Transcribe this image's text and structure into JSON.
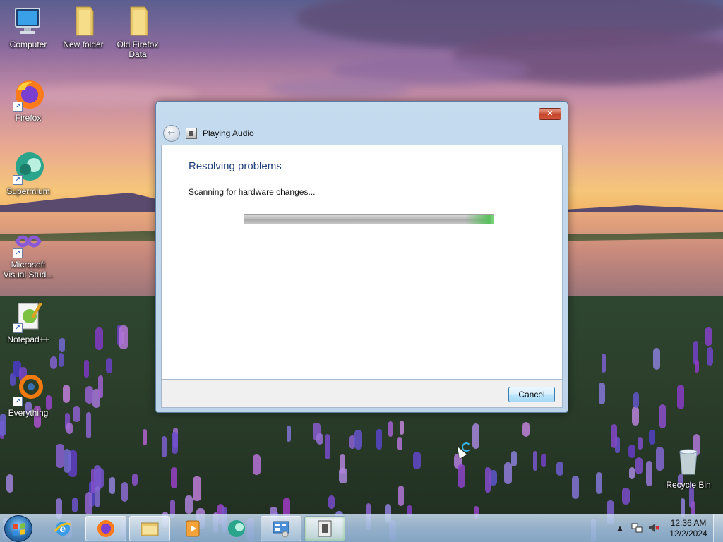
{
  "desktop": {
    "icons": [
      {
        "label": "Computer",
        "icon": "computer-icon"
      },
      {
        "label": "New folder",
        "icon": "folder-icon"
      },
      {
        "label": "Old Firefox Data",
        "icon": "folder-icon"
      },
      {
        "label": "Firefox",
        "icon": "firefox-icon"
      },
      {
        "label": "Supermium",
        "icon": "supermium-icon"
      },
      {
        "label": "Microsoft Visual Stud...",
        "icon": "visual-studio-icon"
      },
      {
        "label": "Notepad++",
        "icon": "notepadpp-icon"
      },
      {
        "label": "Everything",
        "icon": "everything-icon"
      },
      {
        "label": "Recycle Bin",
        "icon": "recycle-bin-icon"
      }
    ]
  },
  "window": {
    "title": "Playing Audio",
    "heading": "Resolving problems",
    "status": "Scanning for hardware changes...",
    "progress": 1.0,
    "cancel_label": "Cancel",
    "close_glyph": "✕"
  },
  "taskbar": {
    "pinned": [
      {
        "name": "internet-explorer-icon",
        "state": "pinned"
      },
      {
        "name": "firefox-icon",
        "state": "open"
      },
      {
        "name": "file-explorer-icon",
        "state": "open"
      },
      {
        "name": "media-player-icon",
        "state": "pinned"
      },
      {
        "name": "supermium-icon",
        "state": "pinned"
      },
      {
        "name": "control-panel-icon",
        "state": "open"
      },
      {
        "name": "troubleshooter-icon",
        "state": "active"
      }
    ],
    "clock": {
      "time": "12:36 AM",
      "date": "12/2/2024"
    },
    "tray_arrow": "▲"
  },
  "colors": {
    "heading": "#1e3d7b",
    "progress_accent": "#58c05c"
  }
}
